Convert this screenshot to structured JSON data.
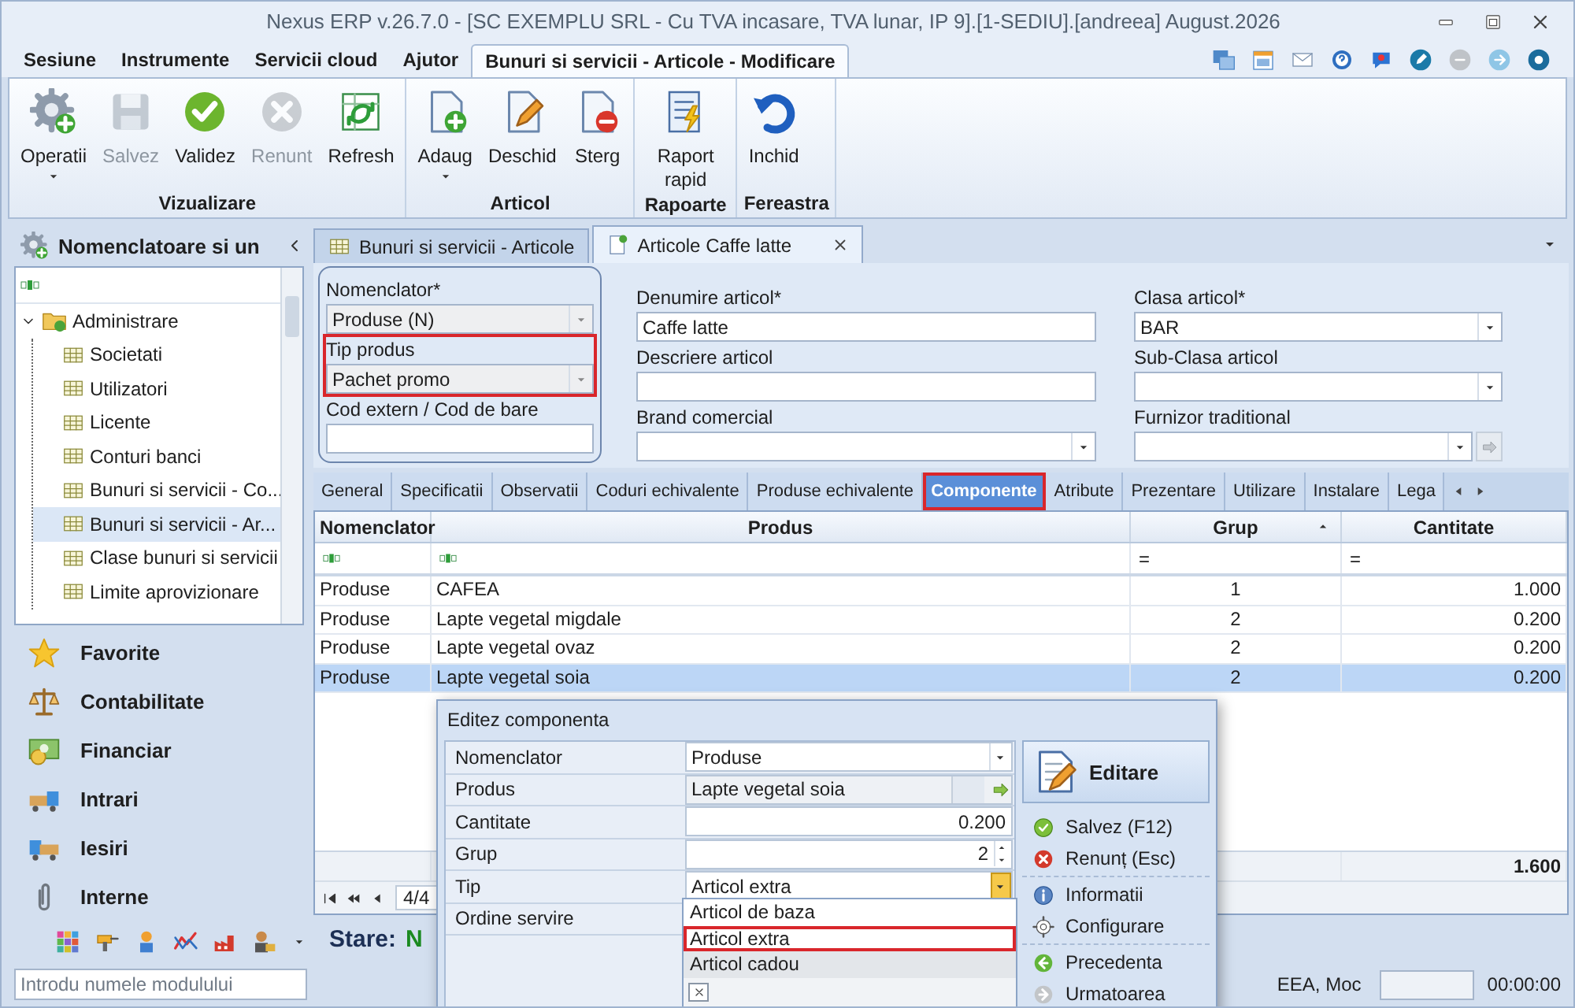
{
  "window": {
    "title": "Nexus ERP v.26.7.0 - [SC EXEMPLU SRL - Cu TVA incasare, TVA lunar, IP 9].[1-SEDIU].[andreea] August.2026"
  },
  "menu_tabs": [
    {
      "label": "Sesiune",
      "selected": false
    },
    {
      "label": "Instrumente",
      "selected": false
    },
    {
      "label": "Servicii cloud",
      "selected": false
    },
    {
      "label": "Ajutor",
      "selected": false
    },
    {
      "label": "Bunuri si servicii - Articole -  Modificare",
      "selected": true
    }
  ],
  "ribbon": [
    {
      "label": "Vizualizare",
      "buttons": [
        {
          "label": "Operatii",
          "dropdown": true,
          "disabled": false
        },
        {
          "label": "Salvez",
          "dropdown": false,
          "disabled": true
        },
        {
          "label": "Validez",
          "dropdown": false,
          "disabled": false
        },
        {
          "label": "Renunt",
          "dropdown": false,
          "disabled": true
        },
        {
          "label": "Refresh",
          "dropdown": false,
          "disabled": false
        }
      ]
    },
    {
      "label": "Articol",
      "buttons": [
        {
          "label": "Adaug",
          "dropdown": true,
          "disabled": false
        },
        {
          "label": "Deschid",
          "dropdown": false,
          "disabled": false
        },
        {
          "label": "Sterg",
          "dropdown": false,
          "disabled": false
        }
      ]
    },
    {
      "label": "Rapoarte",
      "buttons": [
        {
          "label": "Raport rapid",
          "dropdown": false,
          "disabled": false
        }
      ]
    },
    {
      "label": "Fereastra",
      "buttons": [
        {
          "label": "Inchid",
          "dropdown": false,
          "disabled": false
        }
      ]
    }
  ],
  "sidebar": {
    "title": "Nomenclatoare si un",
    "tree": [
      {
        "label": "Administrare",
        "expanded": true,
        "selected": false,
        "children": [
          {
            "label": "Societati",
            "selected": false
          },
          {
            "label": "Utilizatori",
            "selected": false
          },
          {
            "label": "Licente",
            "selected": false
          },
          {
            "label": "Conturi banci",
            "selected": false
          },
          {
            "label": "Bunuri si servicii - Co...",
            "selected": false
          },
          {
            "label": "Bunuri si servicii - Ar...",
            "selected": true
          },
          {
            "label": "Clase bunuri si servicii",
            "selected": false
          },
          {
            "label": "Limite aprovizionare",
            "selected": false
          }
        ]
      }
    ],
    "nav": [
      {
        "label": "Favorite"
      },
      {
        "label": "Contabilitate"
      },
      {
        "label": "Financiar"
      },
      {
        "label": "Intrari"
      },
      {
        "label": "Iesiri"
      },
      {
        "label": "Interne"
      }
    ]
  },
  "doc_tabs": [
    {
      "label": "Bunuri si servicii - Articole",
      "selected": false,
      "closable": false
    },
    {
      "label": "Articole Caffe latte",
      "selected": true,
      "closable": true
    }
  ],
  "form": {
    "columns": [
      [
        {
          "label": "Nomenclator*",
          "value": "Produse (N)",
          "kind": "combo",
          "disabled": true,
          "highlighted": false
        },
        {
          "label": "Tip produs",
          "value": "Pachet promo",
          "kind": "combo",
          "disabled": true,
          "highlighted": true
        },
        {
          "label": "Cod extern / Cod de bare",
          "kind": "text",
          "disabled": false,
          "highlighted": false
        }
      ],
      [
        {
          "label": "Denumire articol*",
          "value": "Caffe latte",
          "kind": "text",
          "disabled": false,
          "highlighted": false
        },
        {
          "label": "Descriere articol",
          "kind": "text",
          "disabled": false,
          "highlighted": false
        },
        {
          "label": "Brand comercial",
          "kind": "combo",
          "disabled": false,
          "highlighted": false
        }
      ],
      [
        {
          "label": "Clasa articol*",
          "value": "BAR",
          "kind": "combo",
          "disabled": false,
          "highlighted": false
        },
        {
          "label": "Sub-Clasa articol",
          "kind": "combo",
          "disabled": false,
          "highlighted": false
        },
        {
          "label": "Furnizor traditional",
          "kind": "combo_action",
          "disabled": false,
          "highlighted": false
        }
      ]
    ]
  },
  "sub_tabs": [
    {
      "label": "General",
      "selected": false,
      "highlighted": false
    },
    {
      "label": "Specificatii",
      "selected": false,
      "highlighted": false
    },
    {
      "label": "Observatii",
      "selected": false,
      "highlighted": false
    },
    {
      "label": "Coduri echivalente",
      "selected": false,
      "highlighted": false
    },
    {
      "label": "Produse echivalente",
      "selected": false,
      "highlighted": false
    },
    {
      "label": "Componente",
      "selected": true,
      "highlighted": true
    },
    {
      "label": "Atribute",
      "selected": false,
      "highlighted": false
    },
    {
      "label": "Prezentare",
      "selected": false,
      "highlighted": false
    },
    {
      "label": "Utilizare",
      "selected": false,
      "highlighted": false
    },
    {
      "label": "Instalare",
      "selected": false,
      "highlighted": false
    },
    {
      "label": "Lega",
      "selected": false,
      "highlighted": false
    }
  ],
  "grid": {
    "columns": [
      {
        "label": "Nomenclator",
        "sorted": false
      },
      {
        "label": "Produs",
        "sorted": false
      },
      {
        "label": "Grup",
        "sorted": true
      },
      {
        "label": "Cantitate",
        "sorted": false
      }
    ],
    "filters": [
      {
        "kind": "text"
      },
      {
        "kind": "text"
      },
      {
        "kind": "number",
        "symbol": "="
      },
      {
        "kind": "number",
        "symbol": "="
      }
    ],
    "rows": [
      {
        "cells": [
          "Produse",
          "CAFEA",
          "1",
          "1.000"
        ],
        "selected": false
      },
      {
        "cells": [
          "Produse",
          "Lapte vegetal migdale",
          "2",
          "0.200"
        ],
        "selected": false
      },
      {
        "cells": [
          "Produse",
          "Lapte vegetal ovaz",
          "2",
          "0.200"
        ],
        "selected": false
      },
      {
        "cells": [
          "Produse",
          "Lapte vegetal soia",
          "2",
          "0.200"
        ],
        "selected": true
      }
    ],
    "total": "1.600",
    "position": "4/4"
  },
  "status": {
    "label": "Stare:",
    "value": "N"
  },
  "dialog": {
    "title": "Editez componenta",
    "properties": [
      {
        "label": "Nomenclator",
        "value": "Produse",
        "kind": "combo"
      },
      {
        "label": "Produs",
        "value": "Lapte vegetal soia",
        "kind": "lookup"
      },
      {
        "label": "Cantitate",
        "value": "0.200",
        "kind": "number"
      },
      {
        "label": "Grup",
        "value": "2",
        "kind": "spin"
      },
      {
        "label": "Tip",
        "value": "Articol extra",
        "kind": "combo_open"
      },
      {
        "label": "Ordine servire",
        "kind": "none"
      }
    ],
    "dropdown": [
      {
        "label": "Articol de baza",
        "selected": false,
        "hovered": false
      },
      {
        "label": "Articol extra",
        "selected": true,
        "hovered": false
      },
      {
        "label": "Articol cadou",
        "selected": false,
        "hovered": true
      }
    ],
    "header": "Editare",
    "actions": [
      [
        {
          "label": "Salvez (F12)"
        },
        {
          "label": "Renunț (Esc)"
        }
      ],
      [
        {
          "label": "Informatii"
        },
        {
          "label": "Configurare"
        }
      ],
      [
        {
          "label": "Precedenta"
        },
        {
          "label": "Urmatoarea"
        }
      ]
    ]
  },
  "status_bar": {
    "module_search": {
      "placeholder": "Introdu numele modulului"
    },
    "panel_text": "EEA, Moc",
    "time": "00:00:00"
  }
}
